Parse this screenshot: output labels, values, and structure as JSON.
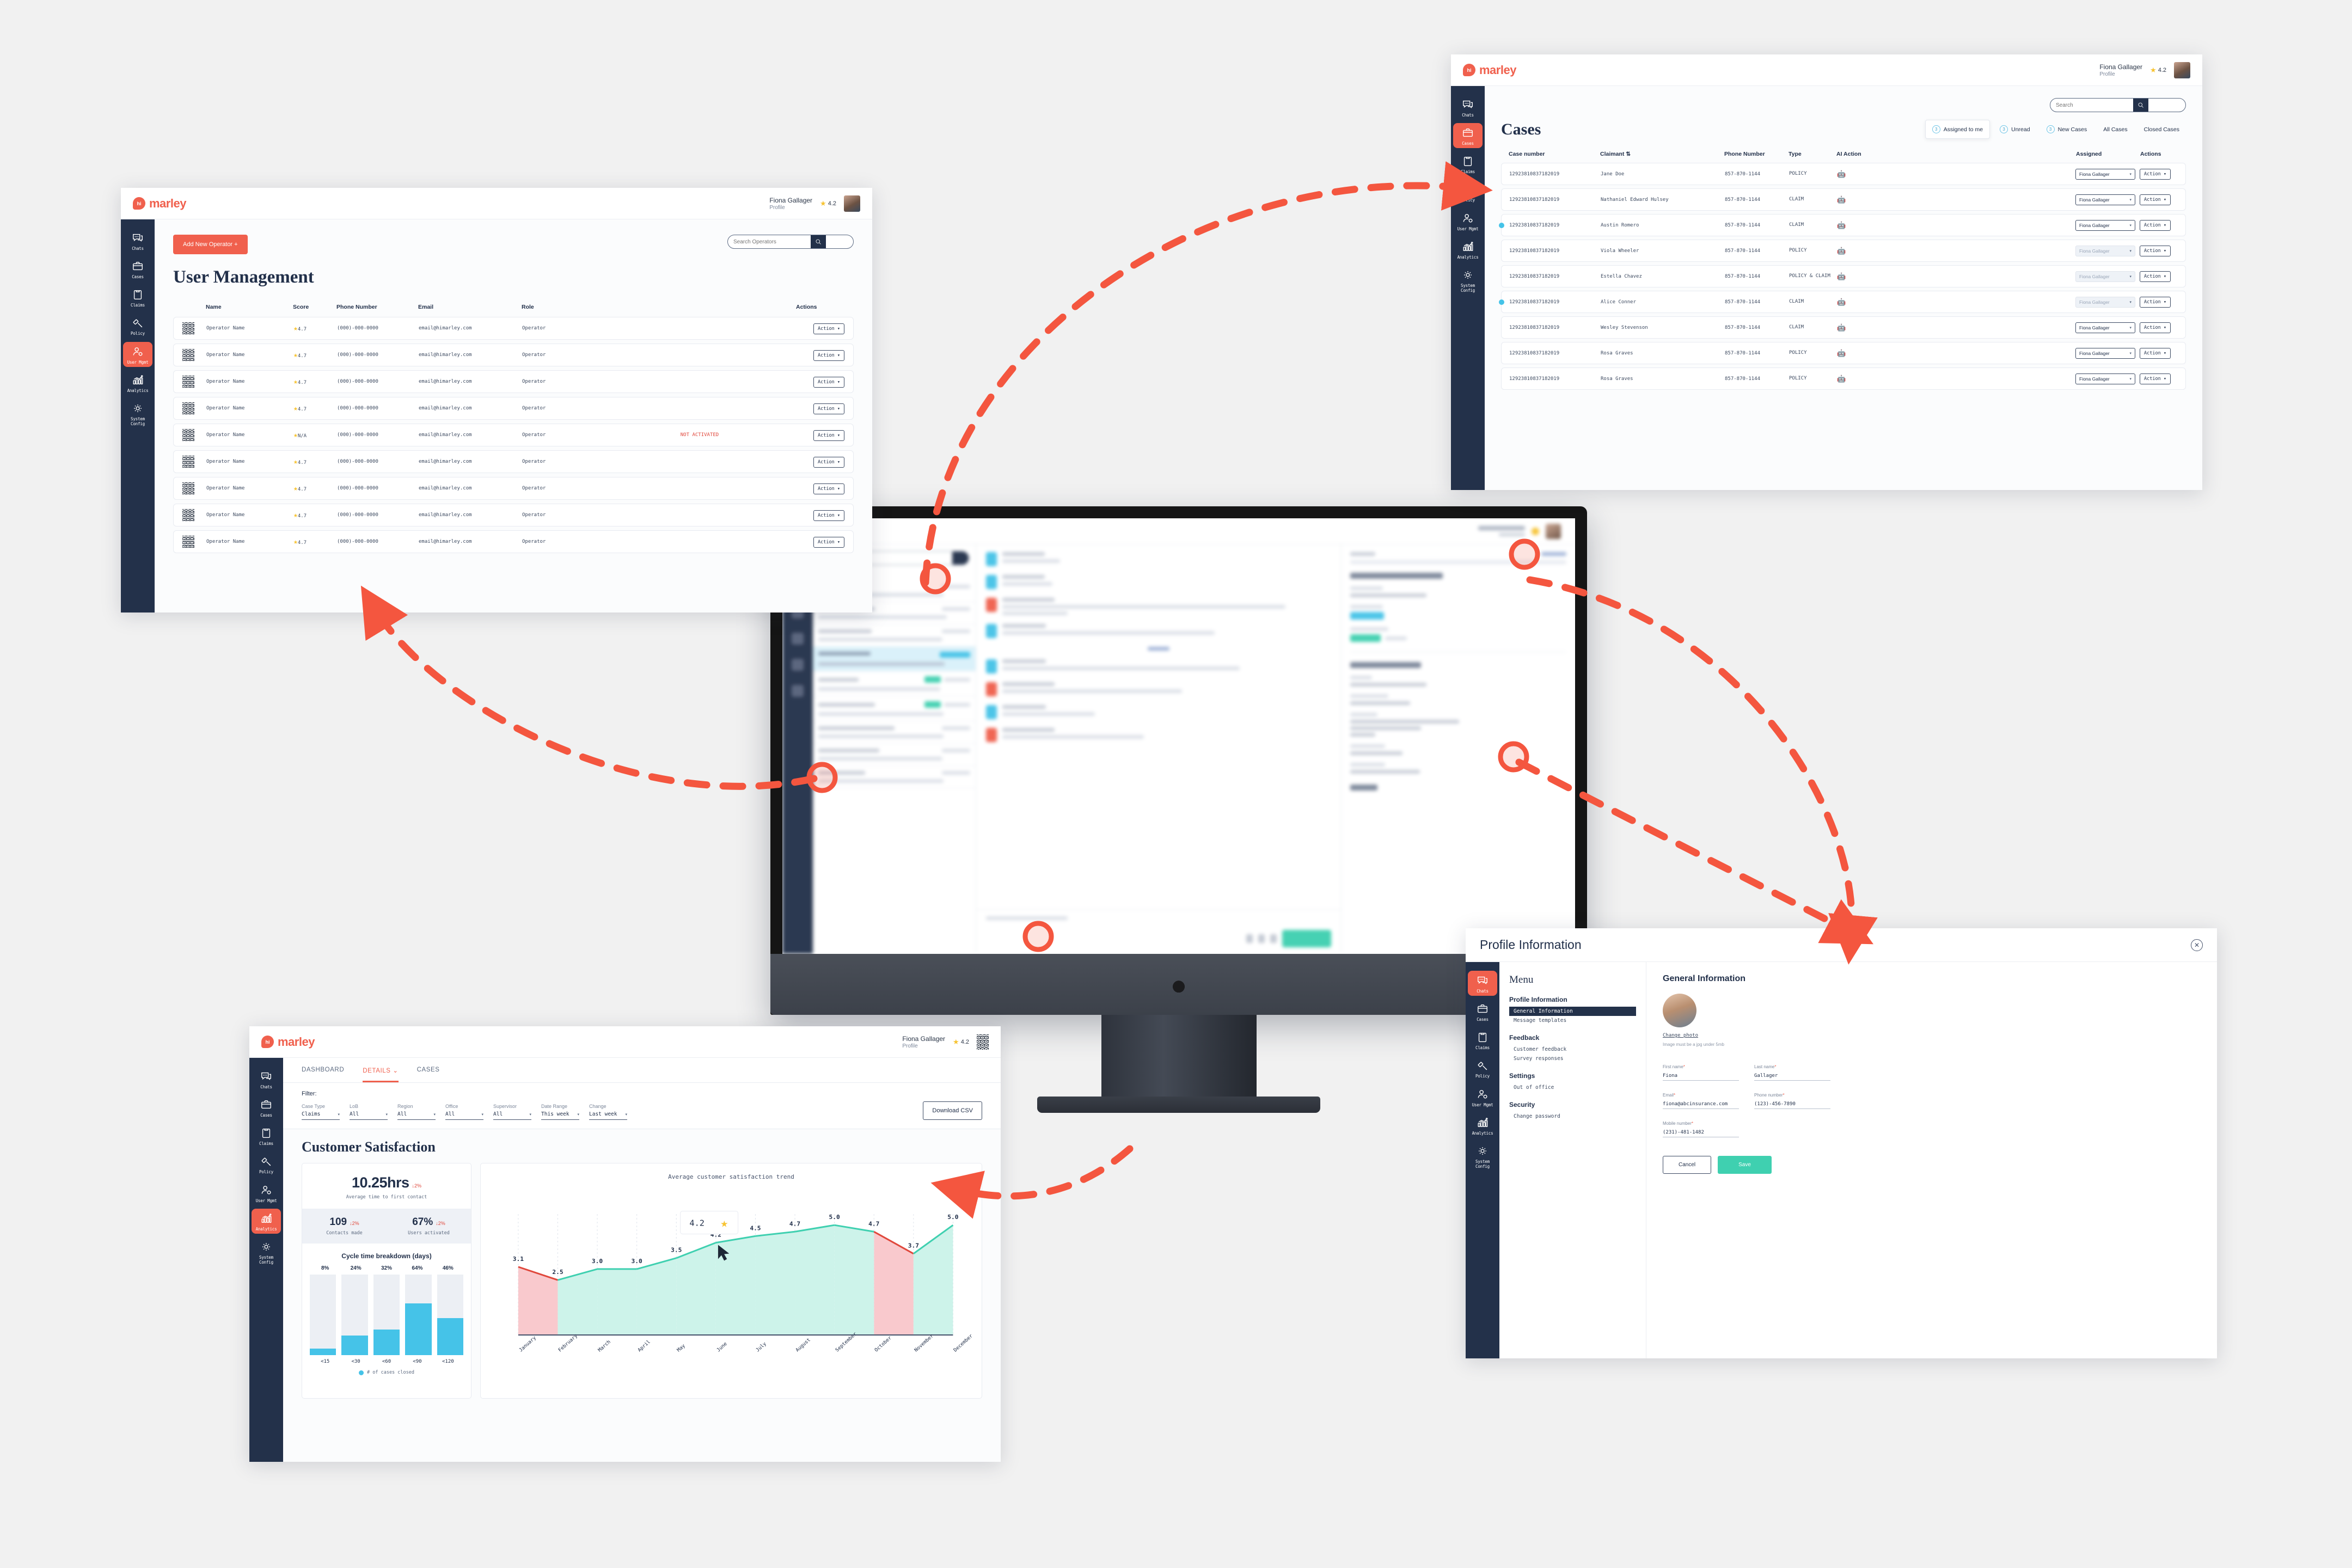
{
  "brand": {
    "logo_hi": "hi",
    "logo_word": "marley",
    "coral": "#f0604d",
    "navy": "#23314a",
    "cyan": "#45c3e8",
    "teal": "#3fd0b0",
    "pink": "#f9c9cd"
  },
  "user": {
    "name": "Fiona Gallager",
    "sub": "Profile",
    "rating": "4.2"
  },
  "nav": [
    {
      "label": "Chats",
      "icon": "chats-icon"
    },
    {
      "label": "Cases",
      "icon": "cases-icon"
    },
    {
      "label": "Claims",
      "icon": "claims-icon"
    },
    {
      "label": "Policy",
      "icon": "policy-icon"
    },
    {
      "label": "User Mgmt",
      "icon": "user-mgmt-icon"
    },
    {
      "label": "Analytics",
      "icon": "analytics-icon"
    },
    {
      "label": "System Config",
      "icon": "system-config-icon"
    }
  ],
  "user_mgmt": {
    "active_nav": "User Mgmt",
    "add_button": "Add New Operator +",
    "search_placeholder": "Search Operators",
    "title": "User Management",
    "columns": [
      "Name",
      "Score",
      "Phone Number",
      "Email",
      "Role",
      "",
      "Actions"
    ],
    "action_label": "Action",
    "not_activated_label": "NOT ACTIVATED",
    "rows": [
      {
        "name": "Operator Name",
        "score": "4.7",
        "phone": "(000)-000-0000",
        "email": "email@himarley.com",
        "role": "Operator",
        "status": ""
      },
      {
        "name": "Operator Name",
        "score": "4.7",
        "phone": "(000)-000-0000",
        "email": "email@himarley.com",
        "role": "Operator",
        "status": ""
      },
      {
        "name": "Operator Name",
        "score": "4.7",
        "phone": "(000)-000-0000",
        "email": "email@himarley.com",
        "role": "Operator",
        "status": ""
      },
      {
        "name": "Operator Name",
        "score": "4.7",
        "phone": "(000)-000-0000",
        "email": "email@himarley.com",
        "role": "Operator",
        "status": ""
      },
      {
        "name": "Operator Name",
        "score": "N/A",
        "phone": "(000)-000-0000",
        "email": "email@himarley.com",
        "role": "Operator",
        "status": "NOT ACTIVATED"
      },
      {
        "name": "Operator Name",
        "score": "4.7",
        "phone": "(000)-000-0000",
        "email": "email@himarley.com",
        "role": "Operator",
        "status": ""
      },
      {
        "name": "Operator Name",
        "score": "4.7",
        "phone": "(000)-000-0000",
        "email": "email@himarley.com",
        "role": "Operator",
        "status": ""
      },
      {
        "name": "Operator Name",
        "score": "4.7",
        "phone": "(000)-000-0000",
        "email": "email@himarley.com",
        "role": "Operator",
        "status": ""
      },
      {
        "name": "Operator Name",
        "score": "4.7",
        "phone": "(000)-000-0000",
        "email": "email@himarley.com",
        "role": "Operator",
        "status": ""
      }
    ]
  },
  "cases": {
    "active_nav": "Cases",
    "title": "Cases",
    "search_placeholder": "Search",
    "filters": [
      {
        "label": "Assigned to me",
        "count": "3",
        "selected": true
      },
      {
        "label": "Unread",
        "count": "3",
        "selected": false
      },
      {
        "label": "New Cases",
        "count": "3",
        "selected": false
      },
      {
        "label": "All Cases",
        "count": "",
        "selected": false
      },
      {
        "label": "Closed Cases",
        "count": "",
        "selected": false
      }
    ],
    "columns": [
      "Case number",
      "Claimant",
      "Phone Number",
      "Type",
      "AI Action",
      "Assigned",
      "Actions"
    ],
    "assigned_value": "Fiona Gallager",
    "action_label": "Action",
    "rows": [
      {
        "case": "12923810837182019",
        "claimant": "Jane Doe",
        "phone": "857-870-1144",
        "type": "POLICY",
        "unread": false,
        "dim": false
      },
      {
        "case": "12923810837182019",
        "claimant": "Nathaniel Edward Hulsey",
        "phone": "857-870-1144",
        "type": "CLAIM",
        "unread": false,
        "dim": false
      },
      {
        "case": "12923810837182019",
        "claimant": "Austin Romero",
        "phone": "857-870-1144",
        "type": "CLAIM",
        "unread": true,
        "dim": false
      },
      {
        "case": "12923810837182019",
        "claimant": "Viola Wheeler",
        "phone": "857-870-1144",
        "type": "POLICY",
        "unread": false,
        "dim": true
      },
      {
        "case": "12923810837182019",
        "claimant": "Estella Chavez",
        "phone": "857-870-1144",
        "type": "POLICY & CLAIM",
        "unread": false,
        "dim": true
      },
      {
        "case": "12923810837182019",
        "claimant": "Alice Conner",
        "phone": "857-870-1144",
        "type": "CLAIM",
        "unread": true,
        "dim": true
      },
      {
        "case": "12923810837182019",
        "claimant": "Wesley Stevenson",
        "phone": "857-870-1144",
        "type": "CLAIM",
        "unread": false,
        "dim": false
      },
      {
        "case": "12923810837182019",
        "claimant": "Rosa Graves",
        "phone": "857-870-1144",
        "type": "POLICY",
        "unread": false,
        "dim": false
      },
      {
        "case": "12923810837182019",
        "claimant": "Rosa Graves",
        "phone": "857-870-1144",
        "type": "POLICY",
        "unread": false,
        "dim": false
      }
    ]
  },
  "analytics": {
    "active_nav": "Analytics",
    "tabs": [
      {
        "label": "DASHBOARD",
        "active": false
      },
      {
        "label": "DETAILS",
        "active": true
      },
      {
        "label": "CASES",
        "active": false
      }
    ],
    "filter_label": "Filter:",
    "filters": [
      {
        "label": "Case Type",
        "value": "Claims"
      },
      {
        "label": "LoB",
        "value": "All"
      },
      {
        "label": "Region",
        "value": "All"
      },
      {
        "label": "Office",
        "value": "All"
      },
      {
        "label": "Supervisor",
        "value": "All"
      },
      {
        "label": "Date Range",
        "value": "This week"
      },
      {
        "label": "Change",
        "value": "Last week"
      }
    ],
    "download_button": "Download CSV",
    "section_title": "Customer Satisfaction",
    "kpi_main": {
      "value": "10.25hrs",
      "delta": "↓2%",
      "caption": "Average time to first contact"
    },
    "kpi_secondary": [
      {
        "value": "109",
        "delta": "↓2%",
        "caption": "Contacts made"
      },
      {
        "value": "67%",
        "delta": "↓2%",
        "caption": "Users activated"
      }
    ],
    "tooltip": {
      "value": "4.2"
    }
  },
  "profile": {
    "active_nav": "Chats",
    "title": "Profile Information",
    "menu_title": "Menu",
    "groups": [
      {
        "heading": "Profile Information",
        "items": [
          {
            "label": "General Information",
            "selected": true
          },
          {
            "label": "Message templates",
            "selected": false
          }
        ]
      },
      {
        "heading": "Feedback",
        "items": [
          {
            "label": "Customer feedback",
            "selected": false
          },
          {
            "label": "Survey responses",
            "selected": false
          }
        ]
      },
      {
        "heading": "Settings",
        "items": [
          {
            "label": "Out of office",
            "selected": false
          }
        ]
      },
      {
        "heading": "Security",
        "items": [
          {
            "label": "Change password",
            "selected": false
          }
        ]
      }
    ],
    "section_title": "General Information",
    "change_photo": "Change photo",
    "photo_hint": "Image must be a jpg under 5mb",
    "fields": [
      {
        "label": "First name",
        "value": "Fiona",
        "required": true
      },
      {
        "label": "Last name",
        "value": "Gallager",
        "required": true
      },
      {
        "label": "Email",
        "value": "fiona@abcinsurance.com",
        "required": true
      },
      {
        "label": "Phone number",
        "value": "(123)-456-7890",
        "required": true
      },
      {
        "label": "Mobile number",
        "value": "(231)-481-1482",
        "required": true
      }
    ],
    "cancel_button": "Cancel",
    "save_button": "Save"
  },
  "chart_data": [
    {
      "type": "bar",
      "title": "Cycle time breakdown (days)",
      "categories": [
        "<15",
        "<30",
        "<60",
        "<90",
        "<120"
      ],
      "values": [
        8,
        24,
        32,
        64,
        46
      ],
      "value_labels": [
        "8%",
        "24%",
        "32%",
        "64%",
        "46%"
      ],
      "legend": [
        "# of cases closed"
      ],
      "legend_position": "bottom",
      "ylim": [
        0,
        100
      ],
      "ylabel": "",
      "xlabel": "",
      "grid": false
    },
    {
      "type": "area",
      "title": "Average customer satisfaction trend",
      "categories": [
        "January",
        "February",
        "March",
        "April",
        "May",
        "June",
        "July",
        "August",
        "September",
        "October",
        "November",
        "December"
      ],
      "values": [
        3.1,
        2.5,
        3.0,
        3.0,
        3.5,
        4.2,
        4.5,
        4.7,
        5.0,
        4.7,
        3.7,
        5.0
      ],
      "value_labels": [
        "3.1",
        "2.5",
        "3.0",
        "3.0",
        "3.5",
        "4.2",
        "4.5",
        "4.7",
        "5.0",
        "4.7",
        "3.7",
        "5.0"
      ],
      "ylim": [
        0,
        5.5
      ],
      "ylabel": "",
      "xlabel": "",
      "grid": true,
      "declining_segments": [
        [
          0,
          1
        ],
        [
          9,
          10
        ]
      ],
      "highlight_index": 5,
      "highlight_label": "4.2"
    }
  ]
}
